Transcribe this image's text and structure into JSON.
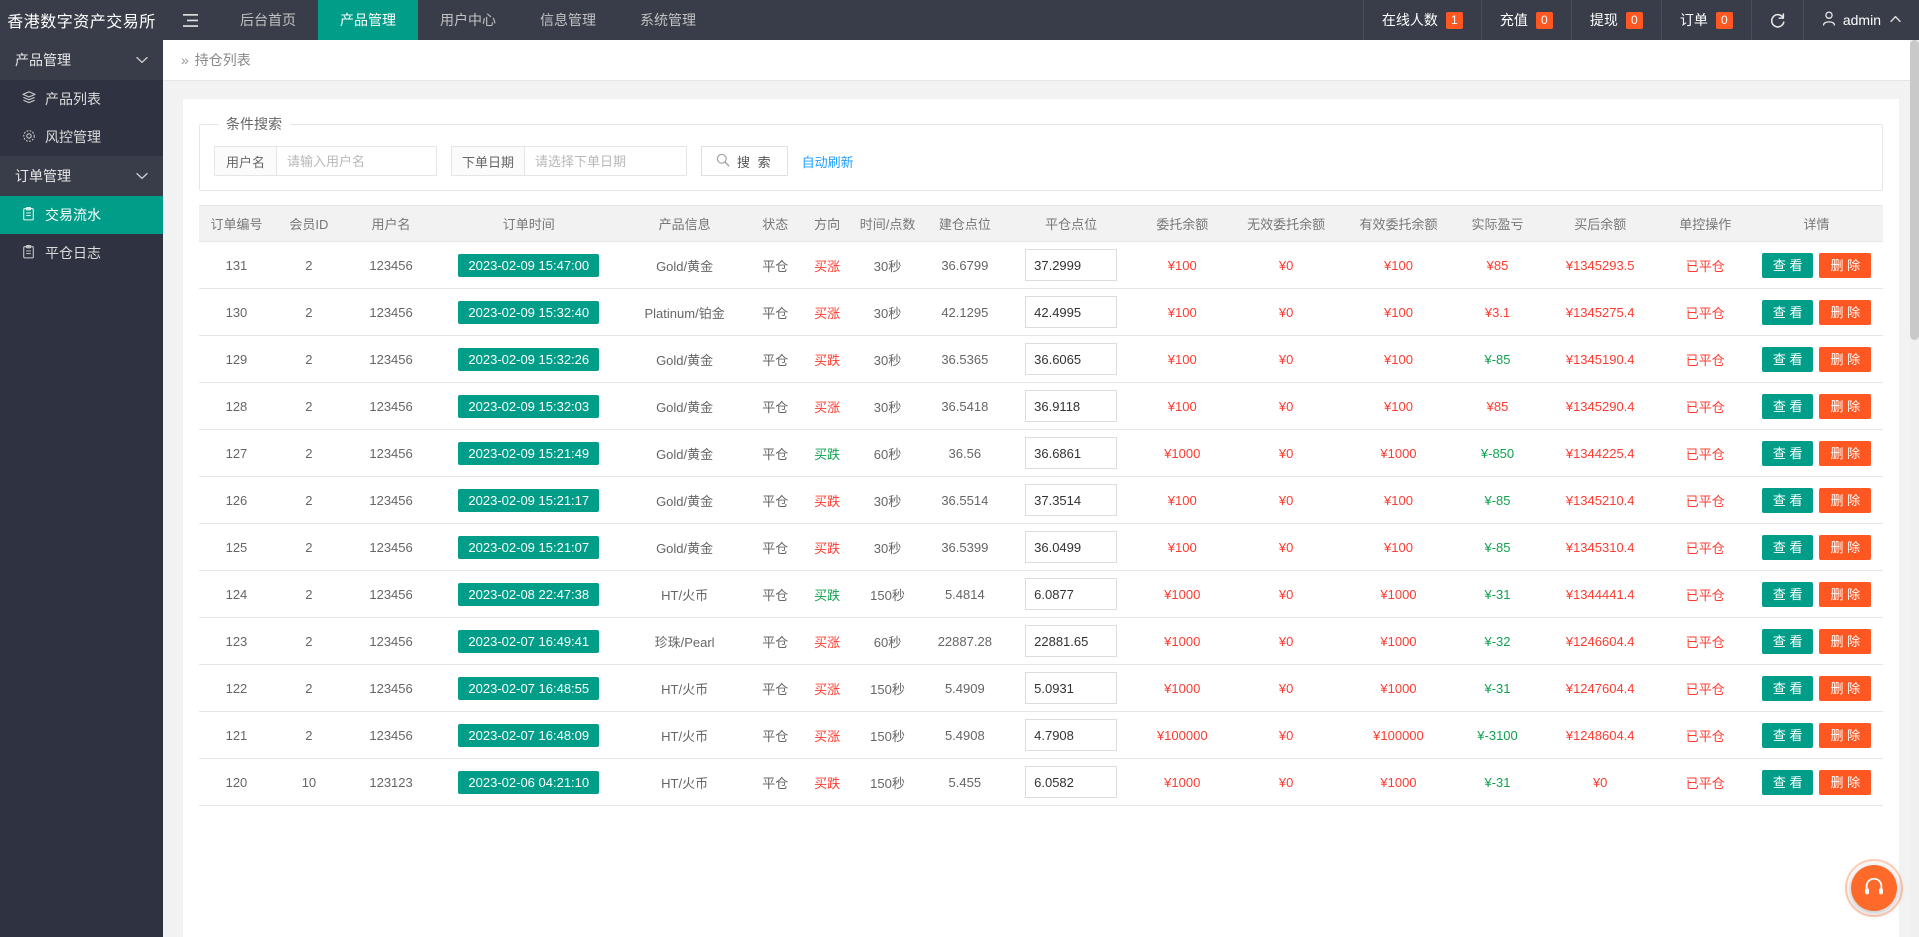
{
  "topbar": {
    "brand": "香港数字资产交易所",
    "hamburger_icon": "menu-icon",
    "nav": [
      {
        "label": "后台首页",
        "active": false
      },
      {
        "label": "产品管理",
        "active": true
      },
      {
        "label": "用户中心",
        "active": false
      },
      {
        "label": "信息管理",
        "active": false
      },
      {
        "label": "系统管理",
        "active": false
      }
    ],
    "stats": [
      {
        "label": "在线人数",
        "count": "1"
      },
      {
        "label": "充值",
        "count": "0"
      },
      {
        "label": "提现",
        "count": "0"
      },
      {
        "label": "订单",
        "count": "0"
      }
    ],
    "refresh_icon": "refresh-icon",
    "user": {
      "icon": "user-icon",
      "name": "admin",
      "caret": "⌃"
    }
  },
  "sidebar": {
    "groups": [
      {
        "title": "产品管理",
        "chevron": "⌄",
        "items": [
          {
            "icon": "layers-icon",
            "glyph": "▤",
            "label": "产品列表",
            "active": false
          },
          {
            "icon": "gear-icon",
            "glyph": "⚙",
            "label": "风控管理",
            "active": false
          }
        ]
      },
      {
        "title": "订单管理",
        "chevron": "⌄",
        "items": [
          {
            "icon": "clipboard-icon",
            "glyph": "▤",
            "label": "交易流水",
            "active": true
          },
          {
            "icon": "clipboard-icon",
            "glyph": "▤",
            "label": "平仓日志",
            "active": false
          }
        ]
      }
    ]
  },
  "breadcrumb": {
    "separator": "»",
    "current": "持仓列表"
  },
  "search": {
    "legend": "条件搜索",
    "username_label": "用户名",
    "username_placeholder": "请输入用户名",
    "username_value": "",
    "orderdate_label": "下单日期",
    "orderdate_placeholder": "请选择下单日期",
    "orderdate_value": "",
    "search_button": "搜 索",
    "search_icon": "search-icon",
    "auto_refresh": "自动刷新"
  },
  "table": {
    "columns": [
      "订单编号",
      "会员ID",
      "用户名",
      "订单时间",
      "产品信息",
      "状态",
      "方向",
      "时间/点数",
      "建仓点位",
      "平仓点位",
      "委托余额",
      "无效委托余额",
      "有效委托余额",
      "实际盈亏",
      "买后余额",
      "单控操作",
      "详情"
    ],
    "view_button": "查 看",
    "delete_button": "删 除",
    "rows": [
      {
        "id": "131",
        "member": "2",
        "user": "123456",
        "time": "2023-02-09 15:47:00",
        "product": "Gold/黄金",
        "status": "平仓",
        "direction": "买涨",
        "dir_color": "red",
        "duration": "30秒",
        "open": "36.6799",
        "close": "37.2999",
        "entrust": "¥100",
        "invalid": "¥0",
        "valid": "¥100",
        "pnl": "¥85",
        "pnl_color": "red",
        "balance": "¥1345293.5",
        "control": "已平仓"
      },
      {
        "id": "130",
        "member": "2",
        "user": "123456",
        "time": "2023-02-09 15:32:40",
        "product": "Platinum/铂金",
        "status": "平仓",
        "direction": "买涨",
        "dir_color": "red",
        "duration": "30秒",
        "open": "42.1295",
        "close": "42.4995",
        "entrust": "¥100",
        "invalid": "¥0",
        "valid": "¥100",
        "pnl": "¥3.1",
        "pnl_color": "red",
        "balance": "¥1345275.4",
        "control": "已平仓"
      },
      {
        "id": "129",
        "member": "2",
        "user": "123456",
        "time": "2023-02-09 15:32:26",
        "product": "Gold/黄金",
        "status": "平仓",
        "direction": "买跌",
        "dir_color": "red",
        "duration": "30秒",
        "open": "36.5365",
        "close": "36.6065",
        "entrust": "¥100",
        "invalid": "¥0",
        "valid": "¥100",
        "pnl": "¥-85",
        "pnl_color": "green",
        "balance": "¥1345190.4",
        "control": "已平仓"
      },
      {
        "id": "128",
        "member": "2",
        "user": "123456",
        "time": "2023-02-09 15:32:03",
        "product": "Gold/黄金",
        "status": "平仓",
        "direction": "买涨",
        "dir_color": "red",
        "duration": "30秒",
        "open": "36.5418",
        "close": "36.9118",
        "entrust": "¥100",
        "invalid": "¥0",
        "valid": "¥100",
        "pnl": "¥85",
        "pnl_color": "red",
        "balance": "¥1345290.4",
        "control": "已平仓"
      },
      {
        "id": "127",
        "member": "2",
        "user": "123456",
        "time": "2023-02-09 15:21:49",
        "product": "Gold/黄金",
        "status": "平仓",
        "direction": "买跌",
        "dir_color": "green",
        "duration": "60秒",
        "open": "36.56",
        "close": "36.6861",
        "entrust": "¥1000",
        "invalid": "¥0",
        "valid": "¥1000",
        "pnl": "¥-850",
        "pnl_color": "green",
        "balance": "¥1344225.4",
        "control": "已平仓"
      },
      {
        "id": "126",
        "member": "2",
        "user": "123456",
        "time": "2023-02-09 15:21:17",
        "product": "Gold/黄金",
        "status": "平仓",
        "direction": "买跌",
        "dir_color": "red",
        "duration": "30秒",
        "open": "36.5514",
        "close": "37.3514",
        "entrust": "¥100",
        "invalid": "¥0",
        "valid": "¥100",
        "pnl": "¥-85",
        "pnl_color": "green",
        "balance": "¥1345210.4",
        "control": "已平仓"
      },
      {
        "id": "125",
        "member": "2",
        "user": "123456",
        "time": "2023-02-09 15:21:07",
        "product": "Gold/黄金",
        "status": "平仓",
        "direction": "买跌",
        "dir_color": "red",
        "duration": "30秒",
        "open": "36.5399",
        "close": "36.0499",
        "entrust": "¥100",
        "invalid": "¥0",
        "valid": "¥100",
        "pnl": "¥-85",
        "pnl_color": "green",
        "balance": "¥1345310.4",
        "control": "已平仓"
      },
      {
        "id": "124",
        "member": "2",
        "user": "123456",
        "time": "2023-02-08 22:47:38",
        "product": "HT/火币",
        "status": "平仓",
        "direction": "买跌",
        "dir_color": "green",
        "duration": "150秒",
        "open": "5.4814",
        "close": "6.0877",
        "entrust": "¥1000",
        "invalid": "¥0",
        "valid": "¥1000",
        "pnl": "¥-31",
        "pnl_color": "green",
        "balance": "¥1344441.4",
        "control": "已平仓"
      },
      {
        "id": "123",
        "member": "2",
        "user": "123456",
        "time": "2023-02-07 16:49:41",
        "product": "珍珠/Pearl",
        "status": "平仓",
        "direction": "买涨",
        "dir_color": "red",
        "duration": "60秒",
        "open": "22887.28",
        "close": "22881.65",
        "entrust": "¥1000",
        "invalid": "¥0",
        "valid": "¥1000",
        "pnl": "¥-32",
        "pnl_color": "green",
        "balance": "¥1246604.4",
        "control": "已平仓"
      },
      {
        "id": "122",
        "member": "2",
        "user": "123456",
        "time": "2023-02-07 16:48:55",
        "product": "HT/火币",
        "status": "平仓",
        "direction": "买涨",
        "dir_color": "red",
        "duration": "150秒",
        "open": "5.4909",
        "close": "5.0931",
        "entrust": "¥1000",
        "invalid": "¥0",
        "valid": "¥1000",
        "pnl": "¥-31",
        "pnl_color": "green",
        "balance": "¥1247604.4",
        "control": "已平仓"
      },
      {
        "id": "121",
        "member": "2",
        "user": "123456",
        "time": "2023-02-07 16:48:09",
        "product": "HT/火币",
        "status": "平仓",
        "direction": "买涨",
        "dir_color": "red",
        "duration": "150秒",
        "open": "5.4908",
        "close": "4.7908",
        "entrust": "¥100000",
        "invalid": "¥0",
        "valid": "¥100000",
        "pnl": "¥-3100",
        "pnl_color": "green",
        "balance": "¥1248604.4",
        "control": "已平仓"
      },
      {
        "id": "120",
        "member": "10",
        "user": "123123",
        "time": "2023-02-06 04:21:10",
        "product": "HT/火币",
        "status": "平仓",
        "direction": "买跌",
        "dir_color": "red",
        "duration": "150秒",
        "open": "5.455",
        "close": "6.0582",
        "entrust": "¥1000",
        "invalid": "¥0",
        "valid": "¥1000",
        "pnl": "¥-31",
        "pnl_color": "green",
        "balance": "¥0",
        "control": "已平仓"
      }
    ]
  },
  "fab": {
    "icon": "headset-icon",
    "glyph": "🎧"
  },
  "colors": {
    "brand_dark": "#393D49",
    "sidebar_dark": "#2F3341",
    "accent_teal": "#009E89",
    "accent_orange": "#FF5722",
    "link_blue": "#1E9FFF",
    "value_red": "#FF3B30",
    "value_green": "#12A150"
  }
}
